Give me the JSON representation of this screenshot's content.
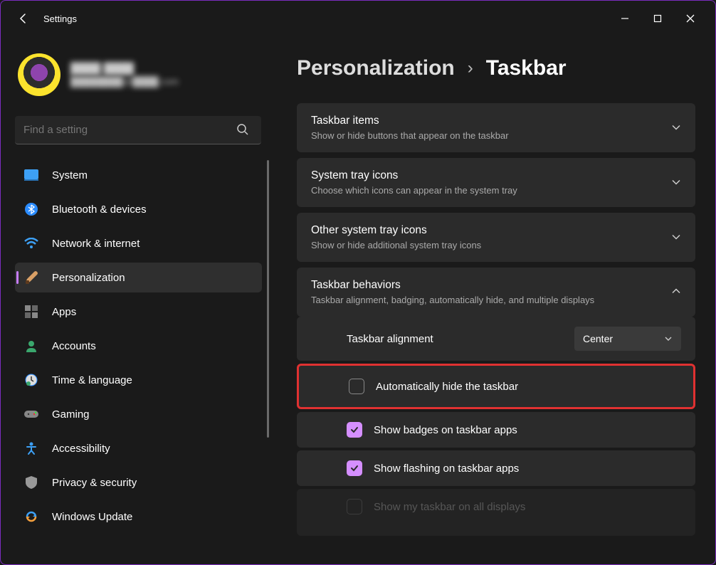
{
  "window": {
    "title": "Settings"
  },
  "user": {
    "name": "████ ████",
    "email": "████████@████.com"
  },
  "search": {
    "placeholder": "Find a setting"
  },
  "nav": {
    "system": "System",
    "bluetooth": "Bluetooth & devices",
    "network": "Network & internet",
    "personalization": "Personalization",
    "apps": "Apps",
    "accounts": "Accounts",
    "time": "Time & language",
    "gaming": "Gaming",
    "accessibility": "Accessibility",
    "privacy": "Privacy & security",
    "update": "Windows Update"
  },
  "breadcrumb": {
    "parent": "Personalization",
    "sep": "›",
    "current": "Taskbar"
  },
  "panels": {
    "items": {
      "title": "Taskbar items",
      "desc": "Show or hide buttons that appear on the taskbar"
    },
    "systray": {
      "title": "System tray icons",
      "desc": "Choose which icons can appear in the system tray"
    },
    "other": {
      "title": "Other system tray icons",
      "desc": "Show or hide additional system tray icons"
    },
    "behaviors": {
      "title": "Taskbar behaviors",
      "desc": "Taskbar alignment, badging, automatically hide, and multiple displays"
    }
  },
  "behaviors": {
    "alignment_label": "Taskbar alignment",
    "alignment_value": "Center",
    "auto_hide": "Automatically hide the taskbar",
    "badges": "Show badges on taskbar apps",
    "flashing": "Show flashing on taskbar apps",
    "all_displays": "Show my taskbar on all displays"
  }
}
